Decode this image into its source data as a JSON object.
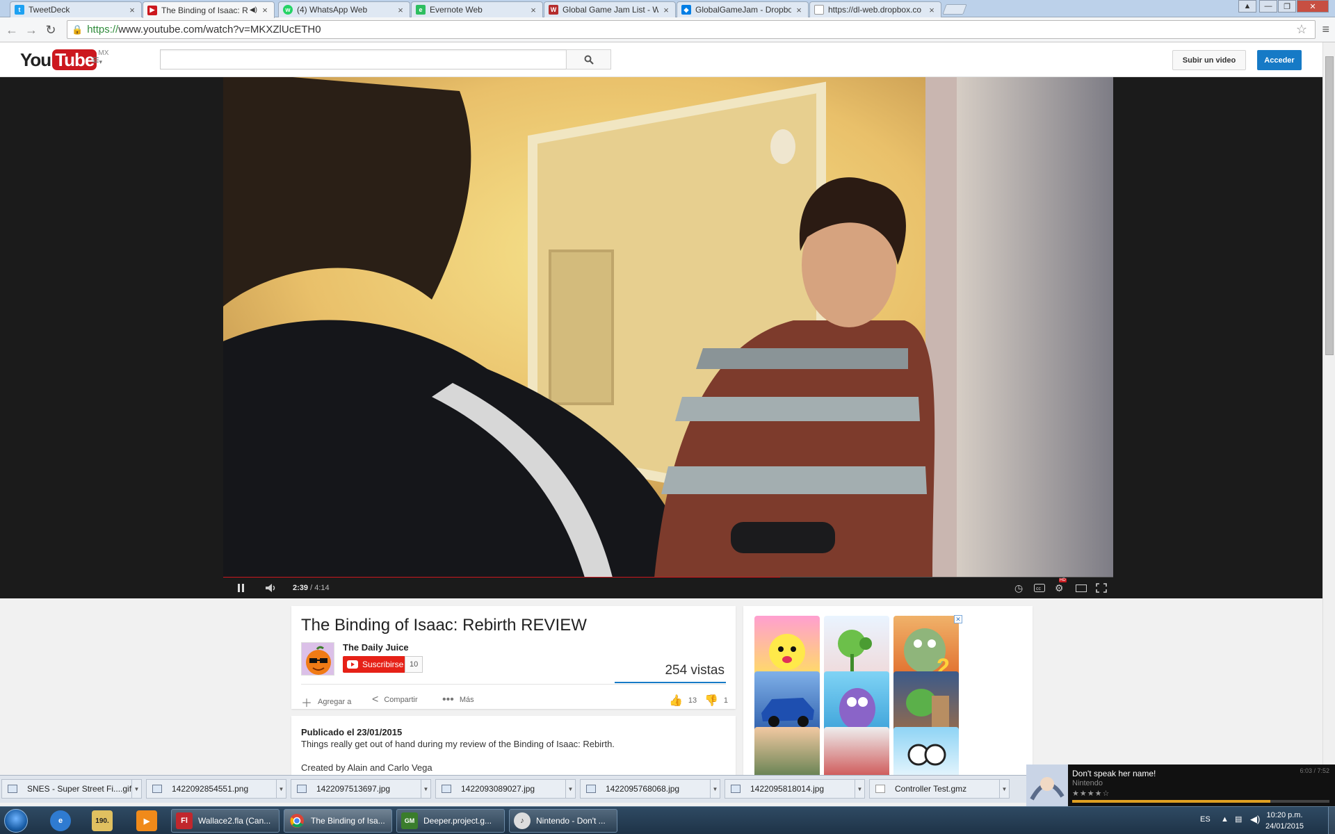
{
  "browser": {
    "tabs": [
      {
        "label": "TweetDeck",
        "color": "#1da1f2"
      },
      {
        "label": "The Binding of Isaac: R",
        "color": "#cc181e",
        "active": true
      },
      {
        "label": "(4) WhatsApp Web",
        "color": "#25d366"
      },
      {
        "label": "Evernote Web",
        "color": "#2dbe60"
      },
      {
        "label": "Global Game Jam List - W",
        "color": "#b52d2d"
      },
      {
        "label": "GlobalGameJam - Dropbo",
        "color": "#007ee5"
      },
      {
        "label": "https://dl-web.dropbox.co",
        "color": "#999999"
      }
    ],
    "url_scheme": "https://",
    "url_rest": "www.youtube.com/watch?v=MKXZlUcETH0"
  },
  "masthead": {
    "logo_you": "You",
    "logo_tube": "Tube",
    "country": "MX",
    "upload_label": "Subir un video",
    "signin_label": "Acceder"
  },
  "player": {
    "current_time": "2:39",
    "duration": "/ 4:14",
    "progress": 0.626,
    "buffered": 0.626,
    "hd_badge": "HD"
  },
  "video": {
    "title": "The Binding of Isaac: Rebirth REVIEW",
    "channel": "The Daily Juice",
    "subscribe_label": "Suscribirse",
    "subscriber_count": "10",
    "views": "254 vistas",
    "actions": {
      "add": "Agregar a",
      "share": "Compartir",
      "more": "Más"
    },
    "likes": "13",
    "dislikes": "1"
  },
  "description": {
    "published": "Publicado el 23/01/2015",
    "text": "Things really get out of hand during my review of the Binding of Isaac: Rebirth.",
    "credits": "Created by Alain and Carlo Vega"
  },
  "downloads": [
    "SNES - Super Street Fi....gif",
    "1422092854551.png",
    "1422097513697.jpg",
    "1422093089027.jpg",
    "1422095768068.jpg",
    "1422095818014.jpg",
    "Controller Test.gmz"
  ],
  "notification": {
    "title": "Don't speak her name!",
    "artist": "Nintendo",
    "time": "6:03 / 7:52",
    "progress": 0.77
  },
  "taskbar": {
    "quick_launch_text": "190.",
    "windows": [
      {
        "label": "Wallace2.fla (Can...",
        "icon": "Fl",
        "color": "#c1272d"
      },
      {
        "label": "The Binding of Isa...",
        "icon": "",
        "color": "#e8e8e8",
        "active": true
      },
      {
        "label": "Deeper.project.g...",
        "icon": "GM",
        "color": "#3a7d2c"
      },
      {
        "label": "Nintendo - Don't ...",
        "icon": "♪",
        "color": "#dddddd"
      }
    ],
    "language": "ES",
    "time": "10:20 p.m.",
    "date": "24/01/2015"
  }
}
